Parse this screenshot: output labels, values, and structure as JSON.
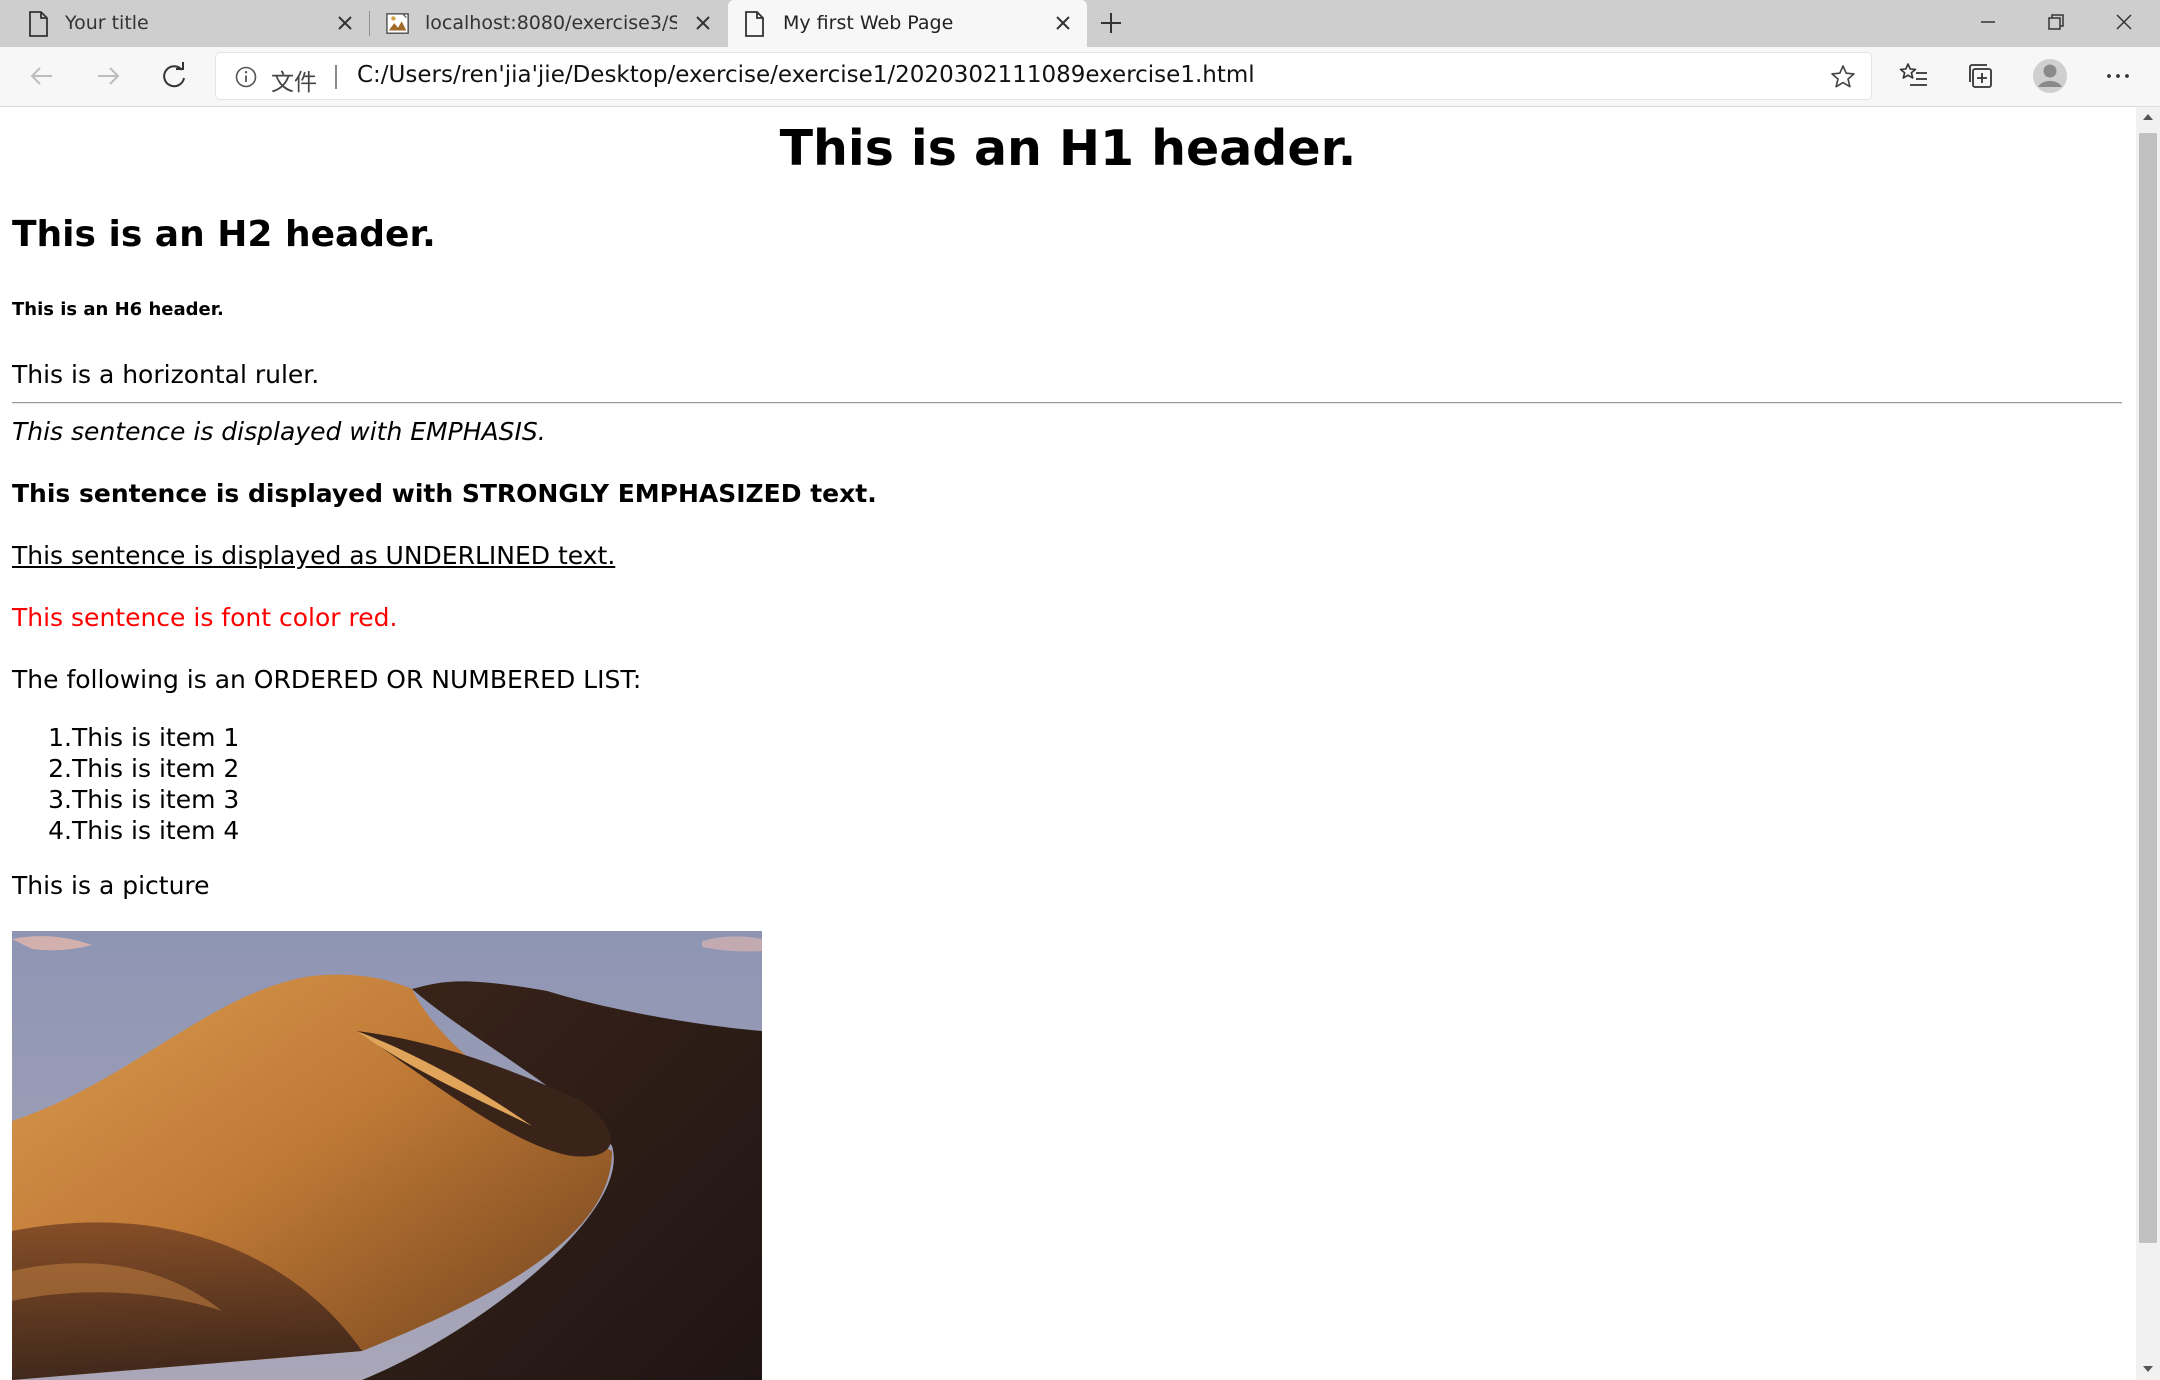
{
  "browser": {
    "tabs": [
      {
        "title": "Your title",
        "active": false,
        "icon": "page-icon"
      },
      {
        "title": "localhost:8080/exercise3/Servlet",
        "active": false,
        "icon": "broken-image-icon"
      },
      {
        "title": "My first Web Page",
        "active": true,
        "icon": "page-icon"
      }
    ],
    "new_tab_icon": "plus-icon",
    "window_controls": [
      "minimize-icon",
      "restore-icon",
      "close-icon"
    ],
    "address_bar": {
      "security_label": "文件",
      "url": "C:/Users/ren'jia'jie/Desktop/exercise/exercise1/2020302111089exercise1.html"
    },
    "toolbar_icons": [
      "back-arrow-icon",
      "forward-arrow-icon",
      "refresh-icon",
      "favorite-star-icon",
      "favorites-list-icon",
      "collections-icon",
      "profile-avatar-icon",
      "more-dots-icon"
    ]
  },
  "page": {
    "h1": "This is an H1 header.",
    "h2": "This is an H2 header.",
    "h6": "This is an H6 header.",
    "hr_text": "This is a horizontal ruler.",
    "emphasis": "This sentence is displayed with EMPHASIS.",
    "strong": "This sentence is displayed with STRONGLY EMPHASIZED text.",
    "underlined": "This sentence is displayed as UNDERLINED text.",
    "red_text": "This sentence is font color red.",
    "list_intro": "The following is an ORDERED OR NUMBERED LIST:",
    "list_items": [
      {
        "num": "1.",
        "text": "This is item 1"
      },
      {
        "num": "2.",
        "text": "This is item 2"
      },
      {
        "num": "3.",
        "text": "This is item 3"
      },
      {
        "num": "4.",
        "text": "This is item 4"
      }
    ],
    "picture_caption": "This is a picture"
  },
  "colors": {
    "red_text": "#ff0000",
    "tabstrip": "#cecece",
    "toolbar": "#f7f7f7"
  }
}
